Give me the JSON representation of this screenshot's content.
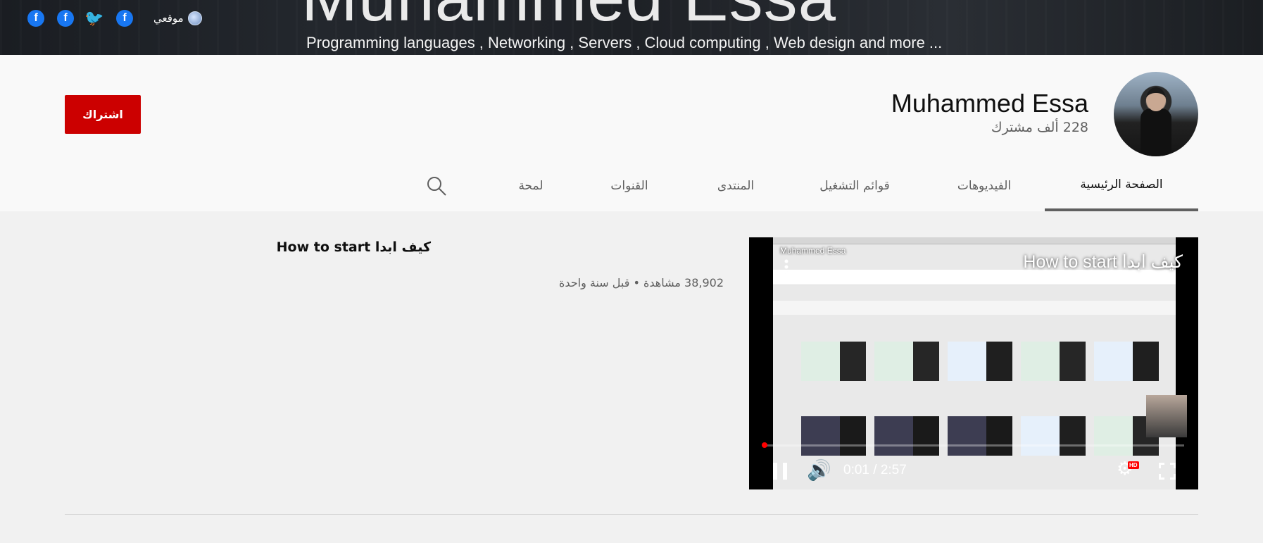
{
  "banner": {
    "title": "Muhammed Essa",
    "subtitle": "Programming languages , Networking , Servers , Cloud computing , Web design and more ...",
    "links": [
      {
        "icon": "facebook-icon",
        "glyph": "f"
      },
      {
        "icon": "facebook-icon",
        "glyph": "f"
      },
      {
        "icon": "twitter-icon",
        "glyph": "🐦"
      },
      {
        "icon": "facebook-icon",
        "glyph": "f"
      }
    ],
    "site_label": "موقعي",
    "site_icon": "globe-icon"
  },
  "channel": {
    "name": "Muhammed Essa",
    "subscribers": "228 ألف مشترك",
    "subscribe_label": "اشتراك",
    "accent_color": "#cc0000"
  },
  "tabs": [
    {
      "label": "الصفحة الرئيسية",
      "active": true
    },
    {
      "label": "الفيديوهات",
      "active": false
    },
    {
      "label": "قوائم التشغيل",
      "active": false
    },
    {
      "label": "المنتدى",
      "active": false
    },
    {
      "label": "القنوات",
      "active": false
    },
    {
      "label": "لمحة",
      "active": false
    }
  ],
  "search_icon": "search-icon",
  "featured": {
    "player_title": "How to start كيف ابدا",
    "player_brand": "Muhammed Essa",
    "time": "0:01 / 2:57",
    "progress": 0.006,
    "hd_badge": "HD",
    "title": "How to start كيف ابدا",
    "meta": "38,902 مشاهدة • قبل سنة واحدة"
  }
}
